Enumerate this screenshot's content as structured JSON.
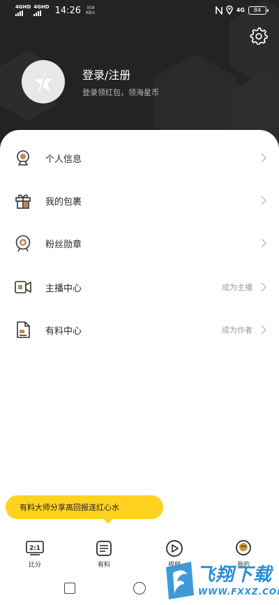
{
  "status_bar": {
    "signal1_label": "4GHD",
    "signal2_label": "4GHD",
    "time": "14:26",
    "speed_value": "358",
    "speed_unit": "KB/s",
    "network_label": "4G",
    "battery": "84"
  },
  "profile": {
    "login_title": "登录/注册",
    "login_subtitle": "登录领红包，领海星币"
  },
  "menu": {
    "items": [
      {
        "label": "个人信息",
        "hint": "",
        "icon": "person-webcam-icon"
      },
      {
        "label": "我的包裹",
        "hint": "",
        "icon": "gift-package-icon"
      },
      {
        "label": "粉丝勋章",
        "hint": "",
        "icon": "fan-medal-icon"
      },
      {
        "label": "主播中心",
        "hint": "成为主播",
        "icon": "streamer-video-icon"
      },
      {
        "label": "有料中心",
        "hint": "成为作者",
        "icon": "document-edit-icon"
      }
    ]
  },
  "tooltip": {
    "text": "有料大师分享高回报连红心水"
  },
  "tabbar": {
    "tabs": [
      {
        "label": "比分",
        "icon_text": "2:1",
        "icon": "score-icon"
      },
      {
        "label": "有料",
        "icon": "article-icon"
      },
      {
        "label": "视频",
        "icon": "play-icon"
      },
      {
        "label": "我的",
        "icon": "profile-icon"
      }
    ]
  },
  "watermark": {
    "text": "飞翔下载",
    "url": "WWW.FXXZ.COM"
  },
  "colors": {
    "header_bg": "#232325",
    "accent_yellow": "#ffd21f",
    "watermark_blue": "#2a8fd6"
  }
}
